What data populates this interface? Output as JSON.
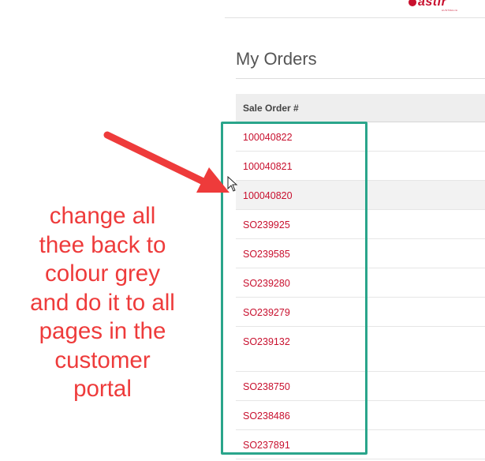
{
  "header": {
    "logo_text": "astir",
    "logo_subtext": "AUSTRALIA"
  },
  "page": {
    "title": "My Orders"
  },
  "orders_table": {
    "column_header": "Sale Order #",
    "rows": [
      "100040822",
      "100040821",
      "100040820",
      "SO239925",
      "SO239585",
      "SO239280",
      "SO239279",
      "SO239132",
      "SO238750",
      "SO238486",
      "SO237891"
    ]
  },
  "annotation": {
    "lines": [
      "change all",
      "thee back to",
      "colour grey",
      "and do it to all",
      "pages in the",
      "customer",
      "portal"
    ],
    "text_color": "#ee3b3b",
    "arrow_color": "#ee3b3b",
    "box_color": "#2aa58b"
  },
  "colors": {
    "link": "#c8102e",
    "hover_row": "#f2f2f2"
  },
  "icons": {
    "cursor": "mouse-pointer-icon",
    "arrow": "annotation-arrow-icon"
  }
}
